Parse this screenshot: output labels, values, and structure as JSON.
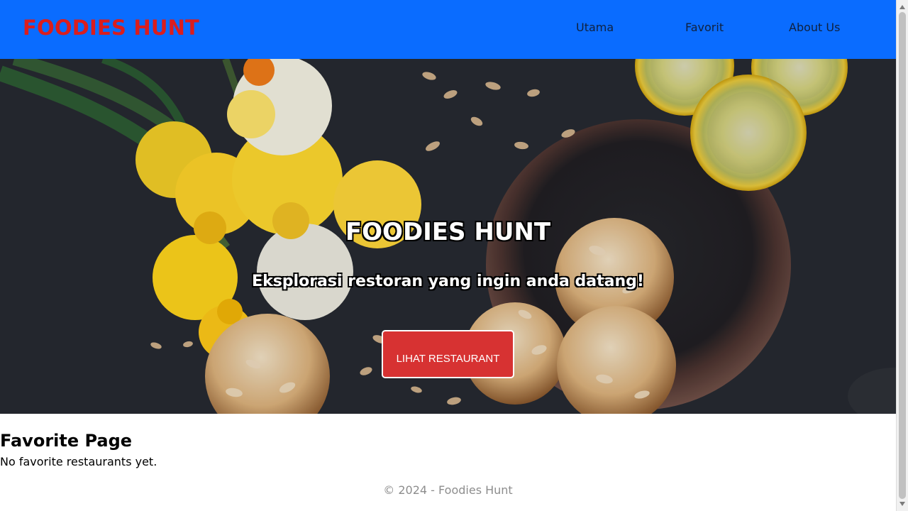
{
  "header": {
    "brand": "FOODIES HUNT",
    "nav": {
      "utama": "Utama",
      "favorit": "Favorit",
      "about": "About Us"
    }
  },
  "hero": {
    "title": "FOODIES HUNT",
    "subtitle": "Eksplorasi restoran yang ingin anda datang!",
    "button_label": "LIHAT RESTAURANT"
  },
  "main": {
    "title": "Favorite Page",
    "empty_message": "No favorite restaurants yet."
  },
  "footer": {
    "text": "© 2024 - Foodies Hunt"
  },
  "colors": {
    "navbar": "#0a6cff",
    "brand": "#db1d1d",
    "button": "#d73232",
    "footer_text": "#8d8d8d"
  },
  "icons": {
    "scroll_up": "triangle-up-icon",
    "scroll_down": "triangle-down-icon"
  }
}
